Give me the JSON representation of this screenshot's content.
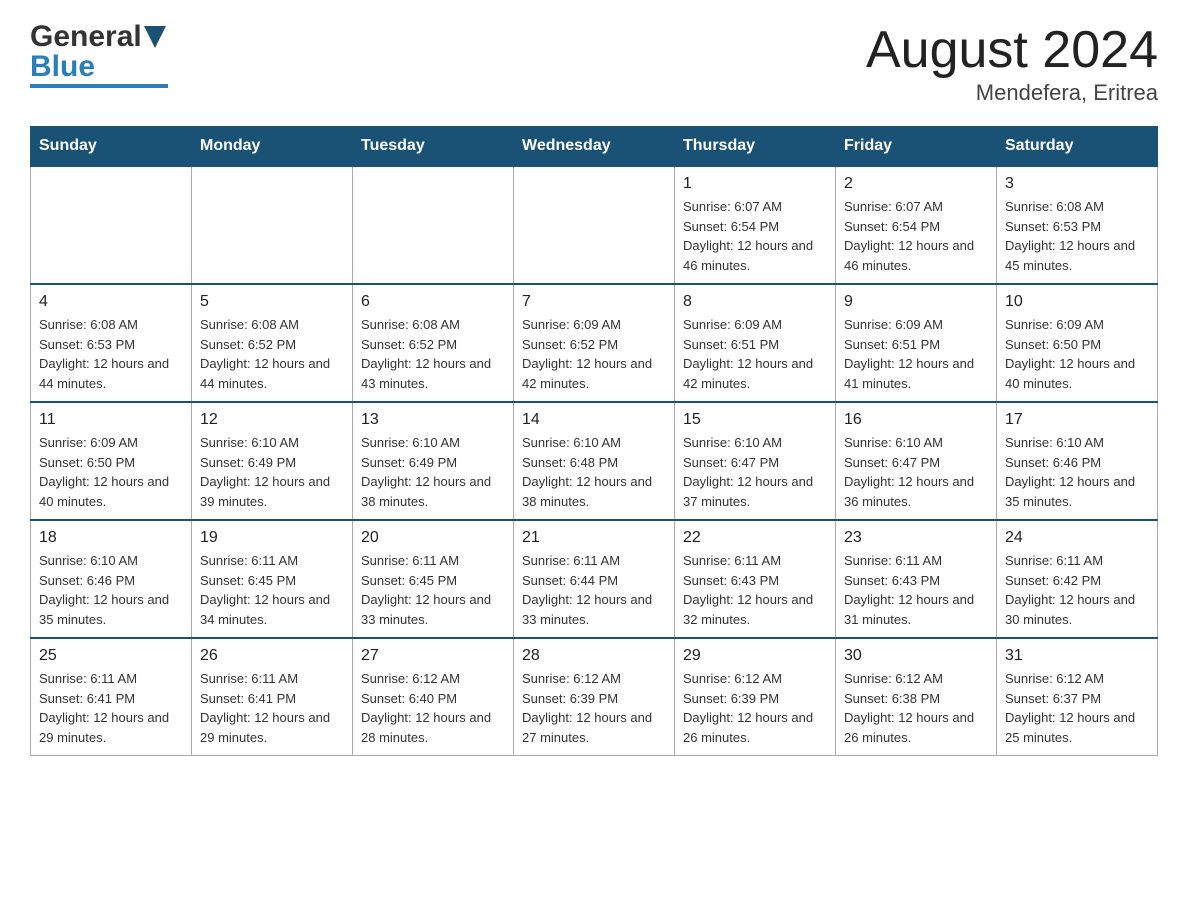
{
  "header": {
    "logo_general": "General",
    "logo_blue": "Blue",
    "month_title": "August 2024",
    "location": "Mendefera, Eritrea"
  },
  "days_of_week": [
    "Sunday",
    "Monday",
    "Tuesday",
    "Wednesday",
    "Thursday",
    "Friday",
    "Saturday"
  ],
  "weeks": [
    [
      {
        "day": "",
        "sunrise": "",
        "sunset": "",
        "daylight": ""
      },
      {
        "day": "",
        "sunrise": "",
        "sunset": "",
        "daylight": ""
      },
      {
        "day": "",
        "sunrise": "",
        "sunset": "",
        "daylight": ""
      },
      {
        "day": "",
        "sunrise": "",
        "sunset": "",
        "daylight": ""
      },
      {
        "day": "1",
        "sunrise": "Sunrise: 6:07 AM",
        "sunset": "Sunset: 6:54 PM",
        "daylight": "Daylight: 12 hours and 46 minutes."
      },
      {
        "day": "2",
        "sunrise": "Sunrise: 6:07 AM",
        "sunset": "Sunset: 6:54 PM",
        "daylight": "Daylight: 12 hours and 46 minutes."
      },
      {
        "day": "3",
        "sunrise": "Sunrise: 6:08 AM",
        "sunset": "Sunset: 6:53 PM",
        "daylight": "Daylight: 12 hours and 45 minutes."
      }
    ],
    [
      {
        "day": "4",
        "sunrise": "Sunrise: 6:08 AM",
        "sunset": "Sunset: 6:53 PM",
        "daylight": "Daylight: 12 hours and 44 minutes."
      },
      {
        "day": "5",
        "sunrise": "Sunrise: 6:08 AM",
        "sunset": "Sunset: 6:52 PM",
        "daylight": "Daylight: 12 hours and 44 minutes."
      },
      {
        "day": "6",
        "sunrise": "Sunrise: 6:08 AM",
        "sunset": "Sunset: 6:52 PM",
        "daylight": "Daylight: 12 hours and 43 minutes."
      },
      {
        "day": "7",
        "sunrise": "Sunrise: 6:09 AM",
        "sunset": "Sunset: 6:52 PM",
        "daylight": "Daylight: 12 hours and 42 minutes."
      },
      {
        "day": "8",
        "sunrise": "Sunrise: 6:09 AM",
        "sunset": "Sunset: 6:51 PM",
        "daylight": "Daylight: 12 hours and 42 minutes."
      },
      {
        "day": "9",
        "sunrise": "Sunrise: 6:09 AM",
        "sunset": "Sunset: 6:51 PM",
        "daylight": "Daylight: 12 hours and 41 minutes."
      },
      {
        "day": "10",
        "sunrise": "Sunrise: 6:09 AM",
        "sunset": "Sunset: 6:50 PM",
        "daylight": "Daylight: 12 hours and 40 minutes."
      }
    ],
    [
      {
        "day": "11",
        "sunrise": "Sunrise: 6:09 AM",
        "sunset": "Sunset: 6:50 PM",
        "daylight": "Daylight: 12 hours and 40 minutes."
      },
      {
        "day": "12",
        "sunrise": "Sunrise: 6:10 AM",
        "sunset": "Sunset: 6:49 PM",
        "daylight": "Daylight: 12 hours and 39 minutes."
      },
      {
        "day": "13",
        "sunrise": "Sunrise: 6:10 AM",
        "sunset": "Sunset: 6:49 PM",
        "daylight": "Daylight: 12 hours and 38 minutes."
      },
      {
        "day": "14",
        "sunrise": "Sunrise: 6:10 AM",
        "sunset": "Sunset: 6:48 PM",
        "daylight": "Daylight: 12 hours and 38 minutes."
      },
      {
        "day": "15",
        "sunrise": "Sunrise: 6:10 AM",
        "sunset": "Sunset: 6:47 PM",
        "daylight": "Daylight: 12 hours and 37 minutes."
      },
      {
        "day": "16",
        "sunrise": "Sunrise: 6:10 AM",
        "sunset": "Sunset: 6:47 PM",
        "daylight": "Daylight: 12 hours and 36 minutes."
      },
      {
        "day": "17",
        "sunrise": "Sunrise: 6:10 AM",
        "sunset": "Sunset: 6:46 PM",
        "daylight": "Daylight: 12 hours and 35 minutes."
      }
    ],
    [
      {
        "day": "18",
        "sunrise": "Sunrise: 6:10 AM",
        "sunset": "Sunset: 6:46 PM",
        "daylight": "Daylight: 12 hours and 35 minutes."
      },
      {
        "day": "19",
        "sunrise": "Sunrise: 6:11 AM",
        "sunset": "Sunset: 6:45 PM",
        "daylight": "Daylight: 12 hours and 34 minutes."
      },
      {
        "day": "20",
        "sunrise": "Sunrise: 6:11 AM",
        "sunset": "Sunset: 6:45 PM",
        "daylight": "Daylight: 12 hours and 33 minutes."
      },
      {
        "day": "21",
        "sunrise": "Sunrise: 6:11 AM",
        "sunset": "Sunset: 6:44 PM",
        "daylight": "Daylight: 12 hours and 33 minutes."
      },
      {
        "day": "22",
        "sunrise": "Sunrise: 6:11 AM",
        "sunset": "Sunset: 6:43 PM",
        "daylight": "Daylight: 12 hours and 32 minutes."
      },
      {
        "day": "23",
        "sunrise": "Sunrise: 6:11 AM",
        "sunset": "Sunset: 6:43 PM",
        "daylight": "Daylight: 12 hours and 31 minutes."
      },
      {
        "day": "24",
        "sunrise": "Sunrise: 6:11 AM",
        "sunset": "Sunset: 6:42 PM",
        "daylight": "Daylight: 12 hours and 30 minutes."
      }
    ],
    [
      {
        "day": "25",
        "sunrise": "Sunrise: 6:11 AM",
        "sunset": "Sunset: 6:41 PM",
        "daylight": "Daylight: 12 hours and 29 minutes."
      },
      {
        "day": "26",
        "sunrise": "Sunrise: 6:11 AM",
        "sunset": "Sunset: 6:41 PM",
        "daylight": "Daylight: 12 hours and 29 minutes."
      },
      {
        "day": "27",
        "sunrise": "Sunrise: 6:12 AM",
        "sunset": "Sunset: 6:40 PM",
        "daylight": "Daylight: 12 hours and 28 minutes."
      },
      {
        "day": "28",
        "sunrise": "Sunrise: 6:12 AM",
        "sunset": "Sunset: 6:39 PM",
        "daylight": "Daylight: 12 hours and 27 minutes."
      },
      {
        "day": "29",
        "sunrise": "Sunrise: 6:12 AM",
        "sunset": "Sunset: 6:39 PM",
        "daylight": "Daylight: 12 hours and 26 minutes."
      },
      {
        "day": "30",
        "sunrise": "Sunrise: 6:12 AM",
        "sunset": "Sunset: 6:38 PM",
        "daylight": "Daylight: 12 hours and 26 minutes."
      },
      {
        "day": "31",
        "sunrise": "Sunrise: 6:12 AM",
        "sunset": "Sunset: 6:37 PM",
        "daylight": "Daylight: 12 hours and 25 minutes."
      }
    ]
  ]
}
